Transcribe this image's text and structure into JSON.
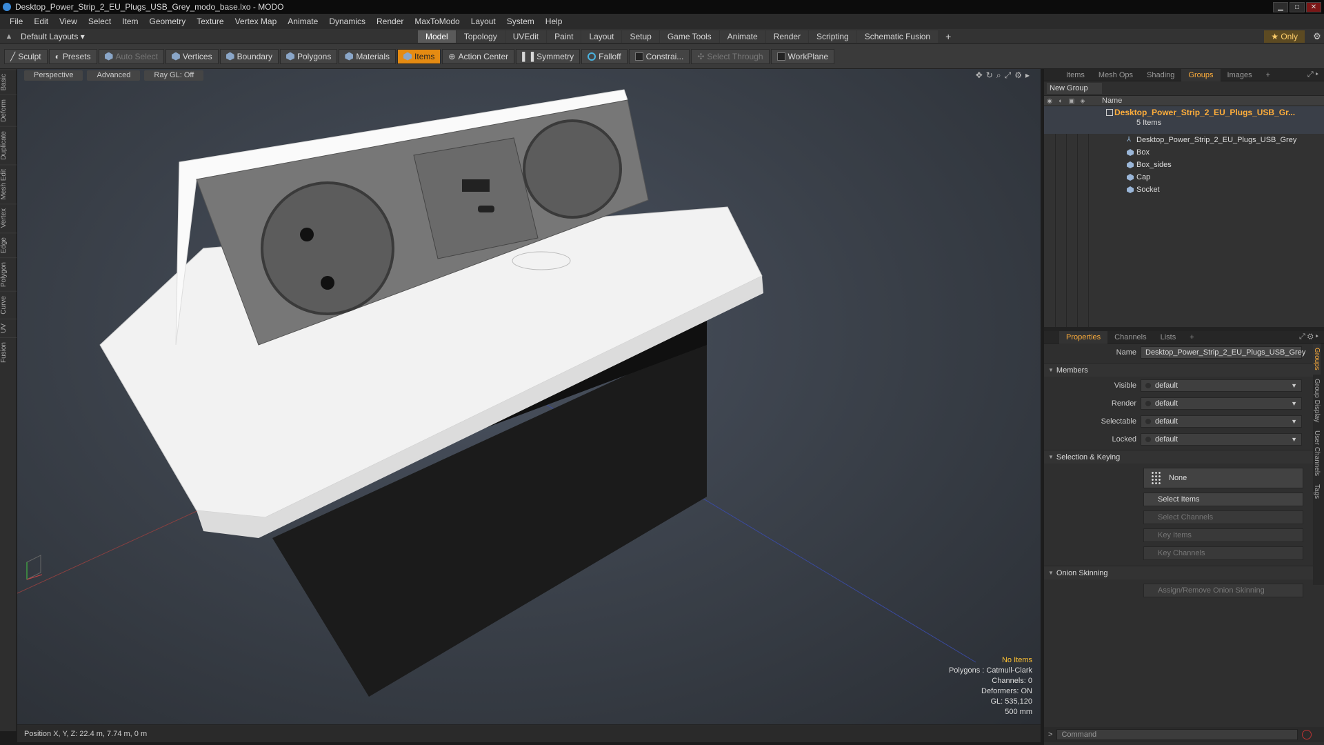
{
  "window": {
    "title": "Desktop_Power_Strip_2_EU_Plugs_USB_Grey_modo_base.lxo - MODO",
    "min": "▁",
    "max": "□",
    "close": "✕"
  },
  "menu": [
    "File",
    "Edit",
    "View",
    "Select",
    "Item",
    "Geometry",
    "Texture",
    "Vertex Map",
    "Animate",
    "Dynamics",
    "Render",
    "MaxToModo",
    "Layout",
    "System",
    "Help"
  ],
  "layoutbar": {
    "layout_label": "Default Layouts ▾",
    "tabs": [
      "Model",
      "Topology",
      "UVEdit",
      "Paint",
      "Layout",
      "Setup",
      "Game Tools",
      "Animate",
      "Render",
      "Scripting",
      "Schematic Fusion"
    ],
    "active_tab": "Model",
    "plus": "+",
    "only": "★  Only"
  },
  "toolbar": {
    "sculpt": "Sculpt",
    "presets": "Presets",
    "auto_select": "Auto Select",
    "vertices": "Vertices",
    "boundary": "Boundary",
    "polygons": "Polygons",
    "materials": "Materials",
    "items": "Items",
    "action_center": "Action Center",
    "symmetry": "Symmetry",
    "falloff": "Falloff",
    "constraints": "Constrai...",
    "select_through": "Select Through",
    "workplane": "WorkPlane"
  },
  "left_tabs": [
    "Basic",
    "Deform",
    "Duplicate",
    "Mesh Edit",
    "Vertex",
    "Edge",
    "Polygon",
    "Curve",
    "UV",
    "Fusion"
  ],
  "viewport": {
    "perspective": "Perspective",
    "advanced": "Advanced",
    "raygl": "Ray GL: Off",
    "info": {
      "items": "No Items",
      "polygons": "Polygons : Catmull-Clark",
      "channels": "Channels: 0",
      "deformers": "Deformers: ON",
      "gl": "GL: 535,120",
      "scale": "500 mm"
    }
  },
  "status": {
    "position": "Position X, Y, Z:   22.4 m, 7.74 m, 0 m"
  },
  "item_panel": {
    "tabs": [
      "Items",
      "Mesh Ops",
      "Shading",
      "Groups",
      "Images",
      "+"
    ],
    "active": "Groups",
    "new_group": "New Group",
    "col_name": "Name",
    "group_name": "Desktop_Power_Strip_2_EU_Plugs_USB_Gr...",
    "group_count": "5 Items",
    "items": [
      "Desktop_Power_Strip_2_EU_Plugs_USB_Grey",
      "Box",
      "Box_sides",
      "Cap",
      "Socket"
    ]
  },
  "properties": {
    "tabs": [
      "Properties",
      "Channels",
      "Lists",
      "+"
    ],
    "active": "Properties",
    "name_label": "Name",
    "name_value": "Desktop_Power_Strip_2_EU_Plugs_USB_Grey",
    "members": "Members",
    "visible_label": "Visible",
    "visible": "default",
    "render_label": "Render",
    "render": "default",
    "selectable_label": "Selectable",
    "selectable": "default",
    "locked_label": "Locked",
    "locked": "default",
    "sel_keying": "Selection & Keying",
    "none": "None",
    "select_items": "Select Items",
    "select_channels": "Select Channels",
    "key_items": "Key Items",
    "key_channels": "Key Channels",
    "onion": "Onion Skinning",
    "onion_btn": "Assign/Remove Onion Skinning",
    "side_tabs": [
      "Groups",
      "Group Display",
      "User Channels",
      "Tags"
    ]
  },
  "command": {
    "placeholder": "Command",
    "prompt": ">"
  },
  "colors": {
    "accent": "#e58b12",
    "group_name": "#ffae3b",
    "info_highlight": "#ffc233"
  }
}
